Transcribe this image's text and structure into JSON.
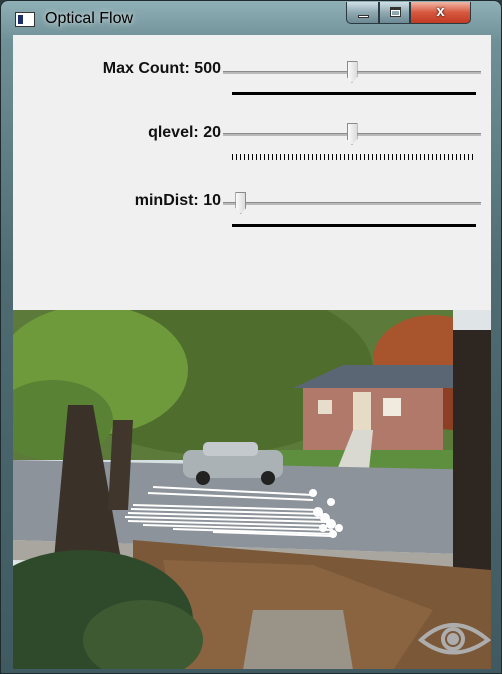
{
  "window": {
    "title": "Optical Flow",
    "close_glyph": "x",
    "title_icon": "window-app-icon"
  },
  "trackbars": [
    {
      "id": "max-count",
      "label": "Max Count: 500",
      "fraction": 0.5,
      "tick_style": "solid"
    },
    {
      "id": "qlevel",
      "label": "qlevel: 20",
      "fraction": 0.5,
      "tick_style": "dotted"
    },
    {
      "id": "min-dist",
      "label": "minDist: 10",
      "fraction": 0.05,
      "tick_style": "solid"
    }
  ],
  "video": {
    "overlay_icon": "eye-icon",
    "flow_track_color": "#ffffff"
  }
}
